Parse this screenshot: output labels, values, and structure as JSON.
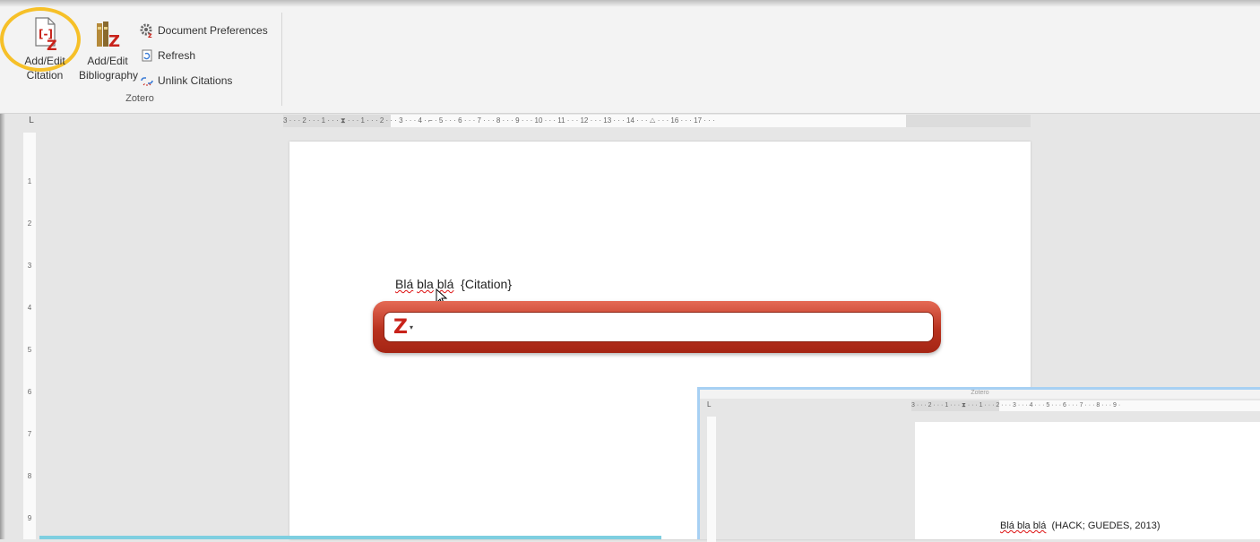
{
  "ribbon": {
    "citation_line1": "Add/Edit",
    "citation_line2": "Citation",
    "bibliography_line1": "Add/Edit",
    "bibliography_line2": "Bibliography",
    "document_preferences": "Document Preferences",
    "refresh": "Refresh",
    "unlink_citations": "Unlink Citations",
    "group_label": "Zotero",
    "highlight_color": "#f6c028"
  },
  "ruler": {
    "corner": "L",
    "numbers": "3 · · · 2 · · · 1 · · · ⧗ · · · 1 · · · 2 · · · 3 · · · 4 · ⌐ · 5 · · · 6 · · · 7 · · · 8 · · · 9 · · · 10 · · · 11 · · · 12 · · · 13 · · · 14 · · · △ · · · 16 · · · 17 · · ·",
    "vertical": [
      "1",
      "2",
      "3",
      "4",
      "5",
      "6",
      "7",
      "8",
      "9"
    ]
  },
  "document": {
    "word1": "Blá",
    "word2": "bla",
    "word3": "blá",
    "citation_placeholder": "{Citation}"
  },
  "zotero_bar": {
    "logo": "Z",
    "caret": "▾",
    "brand_color": "#b8321f"
  },
  "inset": {
    "title": "Zotero",
    "ruler_numbers": "3 · · · 2 · · · 1 · · · ⧗ · · · 1 · · · 2 · · · 3 · · · 4 · · · 5 · · · 6 · · · 7 · · · 8 · · · 9 ·",
    "corner": "L",
    "words": "Blá bla blá",
    "citation": "(HACK; GUEDES, 2013)"
  }
}
